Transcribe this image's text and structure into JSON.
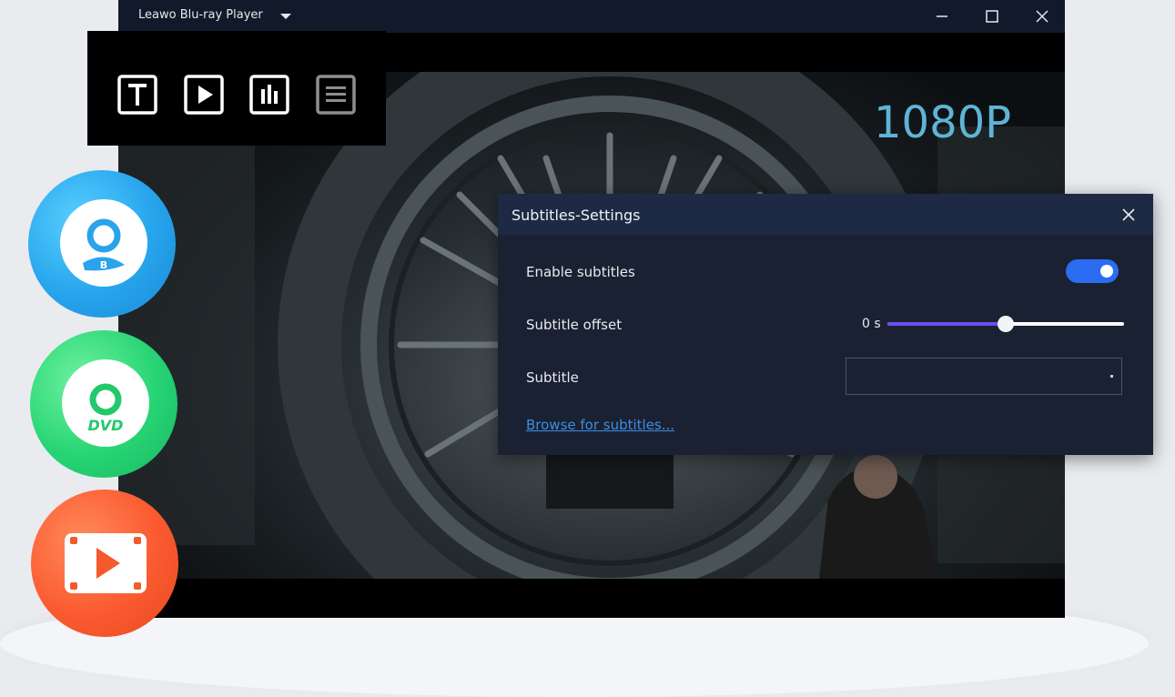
{
  "window": {
    "title": "Leawo Blu-ray Player",
    "controls": [
      "minimize",
      "maximize",
      "close"
    ]
  },
  "video": {
    "resolution_label": "1080P"
  },
  "toolbar": {
    "icons": [
      "subtitle-icon",
      "play-icon",
      "audio-icon",
      "menu-icon"
    ]
  },
  "side_icons": [
    "blu-ray-disc-icon",
    "dvd-disc-icon",
    "video-file-icon"
  ],
  "dialog": {
    "title": "Subtitles-Settings",
    "enable_label": "Enable subtitles",
    "enable_on": true,
    "offset_label": "Subtitle offset",
    "offset_value": "0 s",
    "offset_fraction": 0.5,
    "subtitle_label": "Subtitle",
    "subtitle_selected": "",
    "browse_link": "Browse for subtitles..."
  },
  "colors": {
    "accent_toggle": "#2b6cf2",
    "slider_fill": "#6b4ef0",
    "resolution": "#5fb4d6",
    "link": "#3d8ee0"
  }
}
